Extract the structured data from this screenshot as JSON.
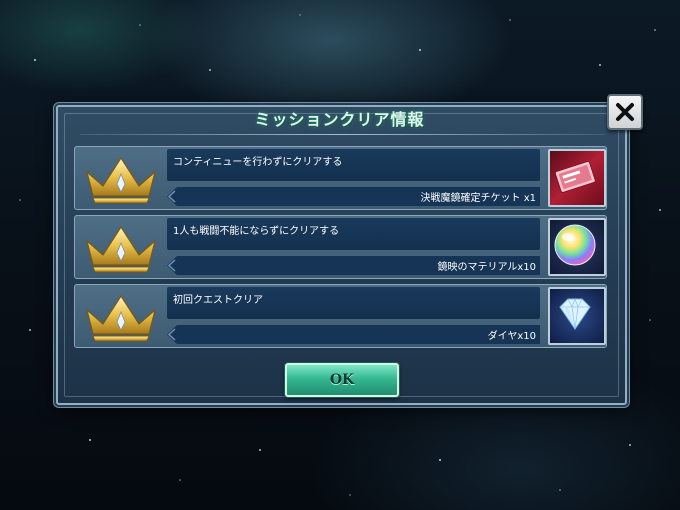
{
  "dialog": {
    "title": "ミッションクリア情報",
    "close_icon": "close-x-icon",
    "ok_label": "OK"
  },
  "missions": [
    {
      "description": "コンティニューを行わずにクリアする",
      "reward": "決戦魔鏡確定チケット x1",
      "icon": "ticket-icon",
      "status_icon": "crown-icon"
    },
    {
      "description": "1人も戦闘不能にならずにクリアする",
      "reward": "鏡映のマテリアルx10",
      "icon": "rainbow-orb-icon",
      "status_icon": "crown-icon"
    },
    {
      "description": "初回クエストクリア",
      "reward": "ダイヤx10",
      "icon": "diamond-icon",
      "status_icon": "crown-icon"
    }
  ],
  "colors": {
    "panel": "#2b455c",
    "row": "#47667e",
    "text_box": "#163556",
    "ok_button": "#35b892",
    "title_glow": "#2a8f76"
  }
}
